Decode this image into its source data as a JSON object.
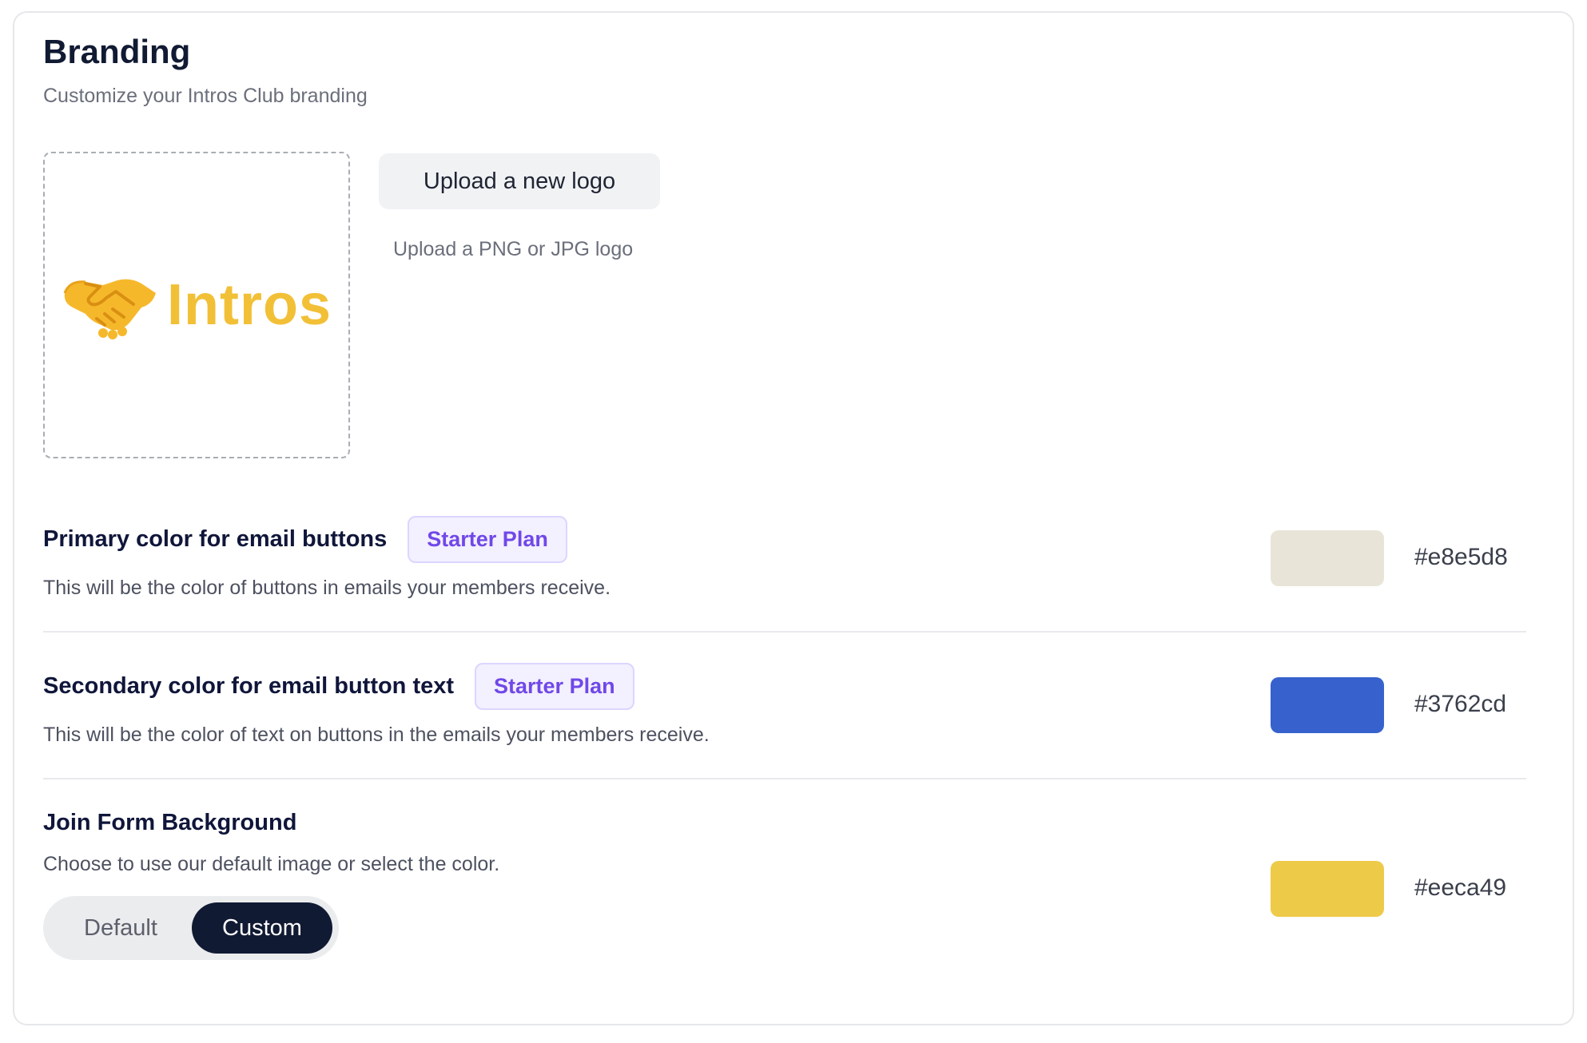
{
  "header": {
    "title": "Branding",
    "subtitle": "Customize your Intros Club branding"
  },
  "logo": {
    "text": "Intros",
    "icon": "handshake-icon",
    "upload_button": "Upload a new logo",
    "upload_hint": "Upload a PNG or JPG logo"
  },
  "primary": {
    "title": "Primary color for email buttons",
    "badge": "Starter Plan",
    "description": "This will be the color of buttons in emails your members receive.",
    "color": "#e8e5d8",
    "hex_label": "#e8e5d8"
  },
  "secondary": {
    "title": "Secondary color for email button text",
    "badge": "Starter Plan",
    "description": "This will be the color of text on buttons in the emails your members receive.",
    "color": "#3762cd",
    "hex_label": "#3762cd"
  },
  "join_form": {
    "title": "Join Form Background",
    "description": "Choose to use our default image or select the color.",
    "color": "#eeca49",
    "hex_label": "#eeca49",
    "toggle": {
      "default_label": "Default",
      "custom_label": "Custom",
      "selected": "Custom"
    }
  },
  "colors": {
    "badge_text": "#7048e8",
    "badge_bg": "#f3f0ff",
    "toggle_active_bg": "#111a33",
    "logo_text": "#f2c037"
  }
}
